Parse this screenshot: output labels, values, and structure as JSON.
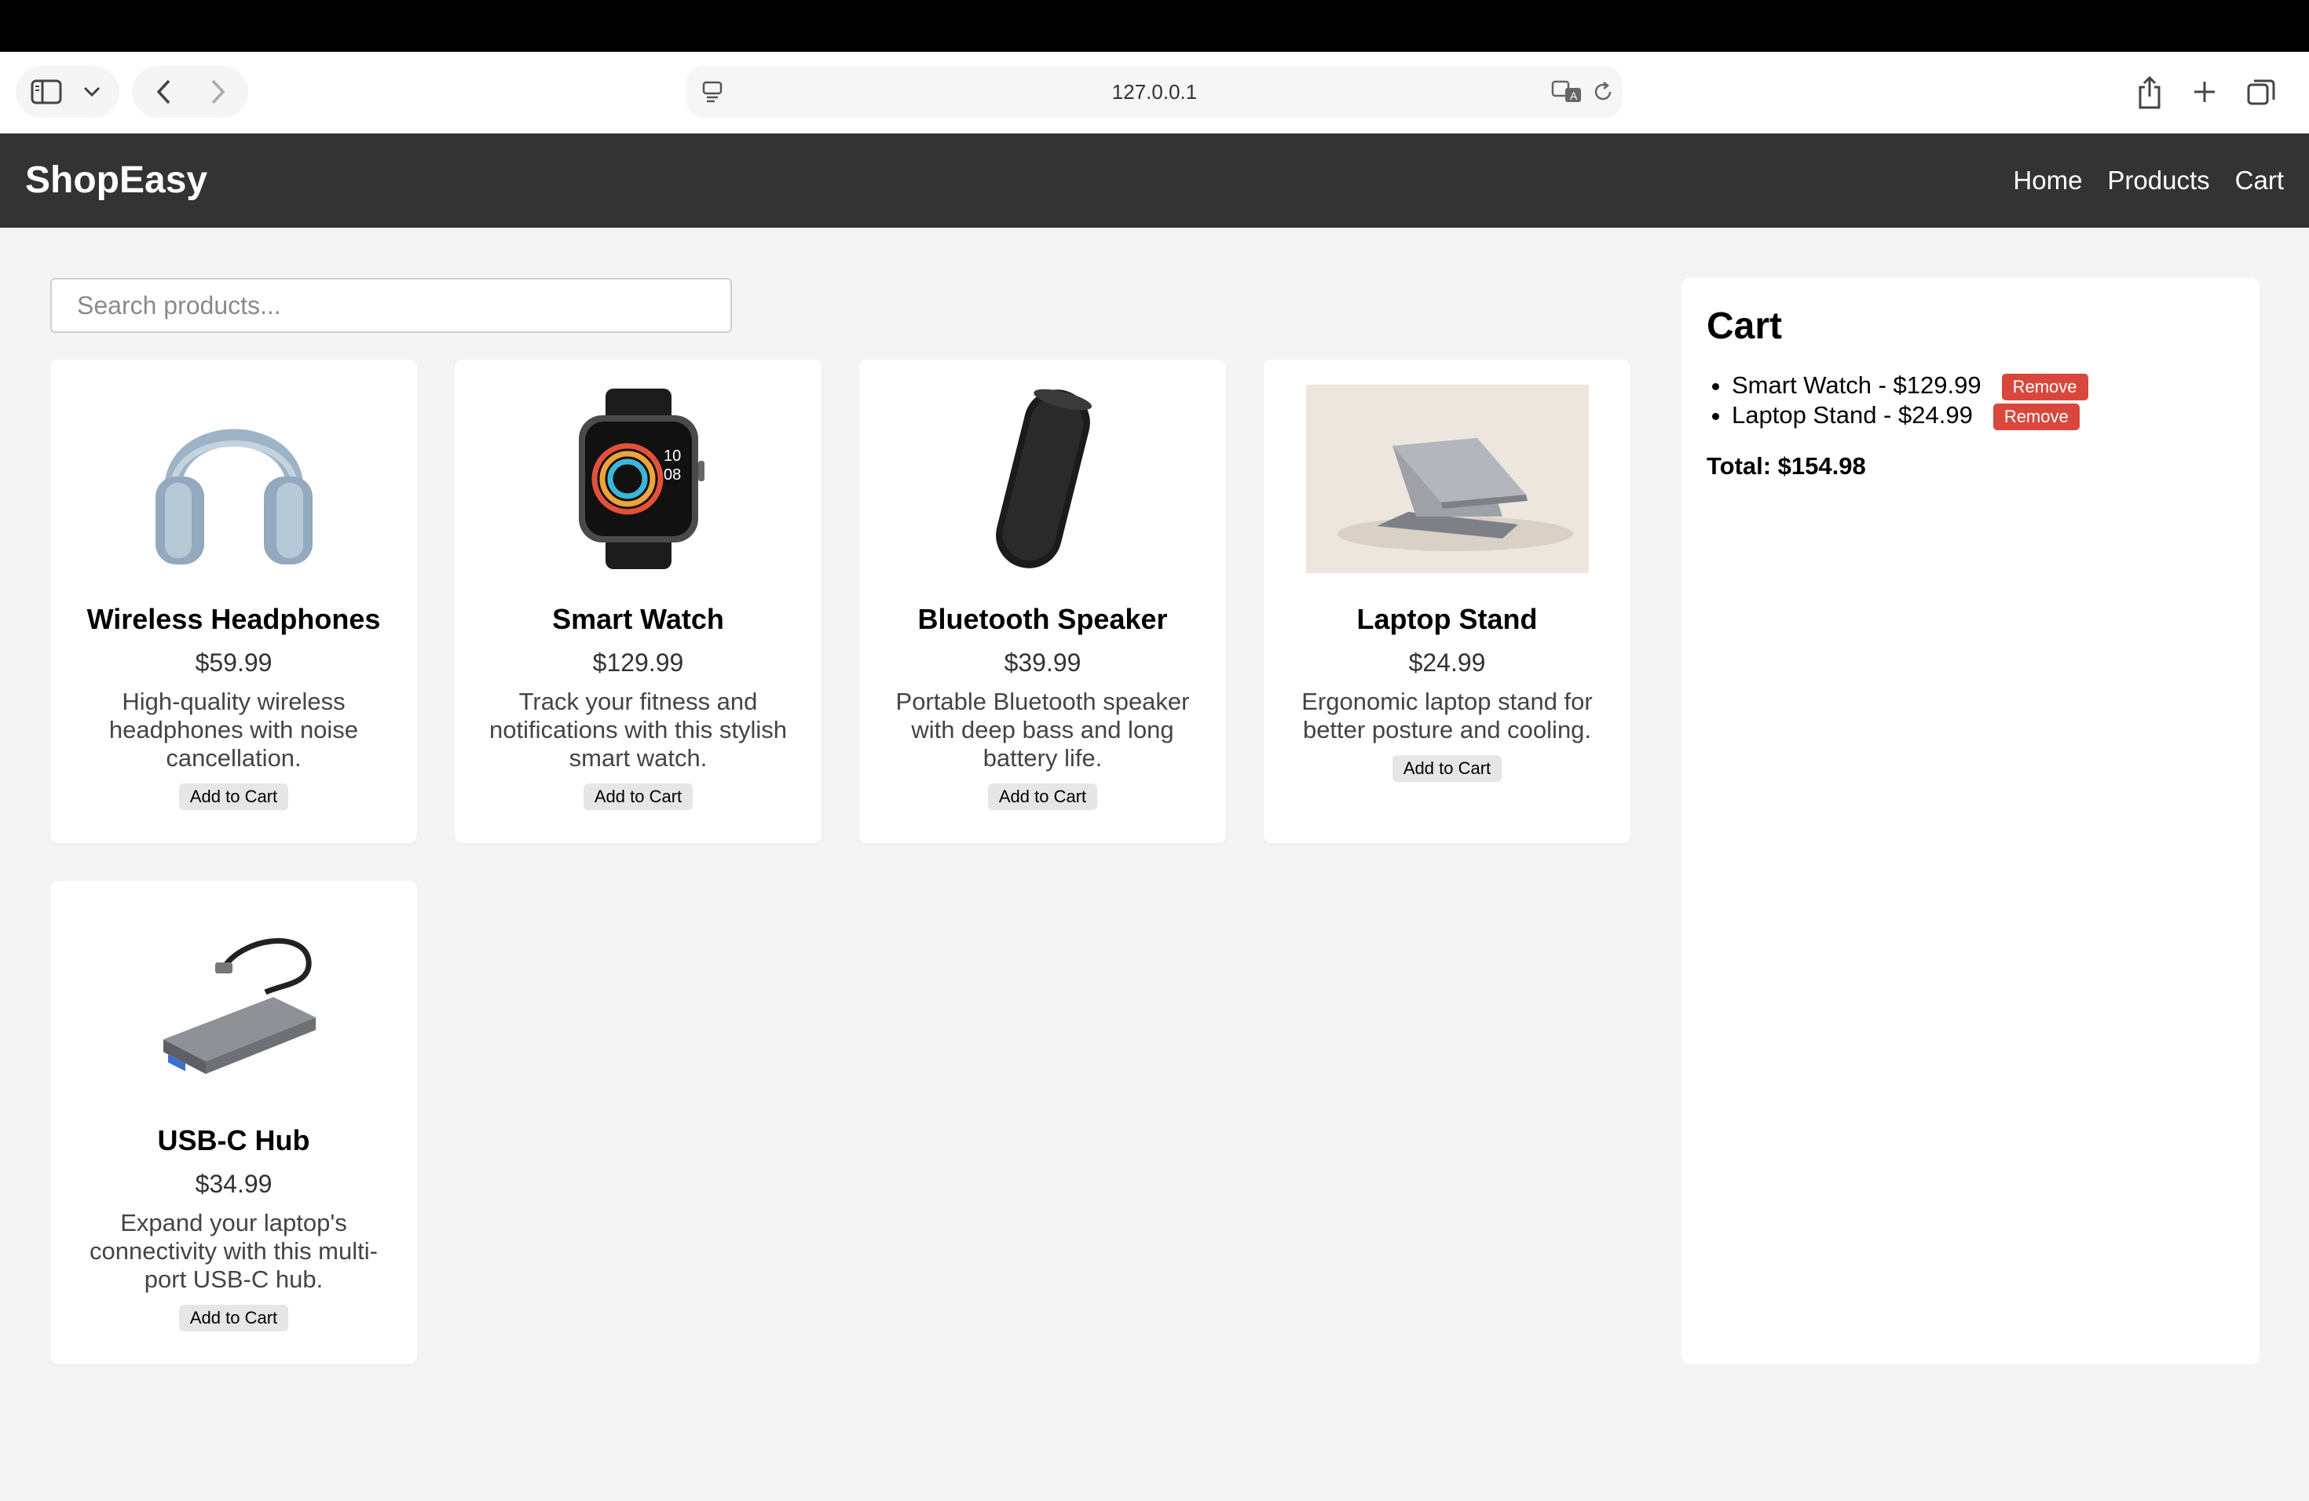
{
  "browser": {
    "url": "127.0.0.1"
  },
  "site": {
    "logo": "ShopEasy",
    "nav": [
      "Home",
      "Products",
      "Cart"
    ]
  },
  "search": {
    "placeholder": "Search products..."
  },
  "products": [
    {
      "name": "Wireless Headphones",
      "price": "$59.99",
      "description": "High-quality wireless headphones with noise cancellation.",
      "button": "Add to Cart",
      "image": "headphones-image"
    },
    {
      "name": "Smart Watch",
      "price": "$129.99",
      "description": "Track your fitness and notifications with this stylish smart watch.",
      "button": "Add to Cart",
      "image": "smartwatch-image"
    },
    {
      "name": "Bluetooth Speaker",
      "price": "$39.99",
      "description": "Portable Bluetooth speaker with deep bass and long battery life.",
      "button": "Add to Cart",
      "image": "speaker-image"
    },
    {
      "name": "Laptop Stand",
      "price": "$24.99",
      "description": "Ergonomic laptop stand for better posture and cooling.",
      "button": "Add to Cart",
      "image": "laptop-stand-image"
    },
    {
      "name": "USB-C Hub",
      "price": "$34.99",
      "description": "Expand your laptop's connectivity with this multi-port USB-C hub.",
      "button": "Add to Cart",
      "image": "usb-hub-image"
    }
  ],
  "cart": {
    "title": "Cart",
    "items": [
      {
        "label": "Smart Watch - $129.99",
        "button": "Remove"
      },
      {
        "label": "Laptop Stand - $24.99",
        "button": "Remove"
      }
    ],
    "total": "Total: $154.98"
  },
  "colors": {
    "header_bg": "#333333",
    "page_bg": "#f4f4f4",
    "remove_btn": "#d9473c"
  }
}
